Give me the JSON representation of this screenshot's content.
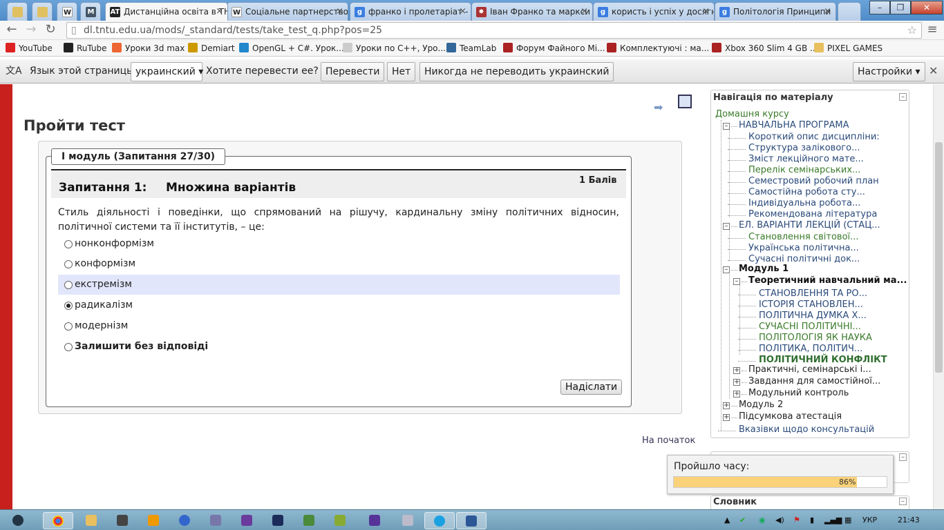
{
  "browser": {
    "tabs": [
      {
        "label": "",
        "icon": "pin-icon"
      },
      {
        "label": "",
        "icon": "pin-icon"
      },
      {
        "label": "",
        "icon": "wikipedia-icon"
      },
      {
        "label": "",
        "icon": "moodle-icon"
      },
      {
        "label": "Дистанційна освіта в ТН",
        "icon": "at-icon",
        "active": true
      },
      {
        "label": "Соціальне партнерство",
        "icon": "wikipedia-icon"
      },
      {
        "label": "франко і пролетаріат -",
        "icon": "google-icon"
      },
      {
        "label": "Іван Франко та маркси",
        "icon": "star-icon"
      },
      {
        "label": "користь і успіх у досягн",
        "icon": "google-icon"
      },
      {
        "label": "Політологія Принципи",
        "icon": "google-icon"
      }
    ],
    "url": "dl.tntu.edu.ua/mods/_standard/tests/take_test_q.php?pos=25",
    "bookmarks": [
      {
        "label": "YouTube",
        "color": "#d22"
      },
      {
        "label": "RuTube",
        "color": "#222"
      },
      {
        "label": "Уроки 3d max",
        "color": "#e63"
      },
      {
        "label": "Demiart",
        "color": "#c90"
      },
      {
        "label": "OpenGL + C#. Урок...",
        "color": "#28c"
      },
      {
        "label": "Уроки по C++, Уро...",
        "color": "#ccc"
      },
      {
        "label": "TeamLab",
        "color": "#369"
      },
      {
        "label": "Форум Файного Мі...",
        "color": "#a22"
      },
      {
        "label": "Комплектуючі : ма...",
        "color": "#a22"
      },
      {
        "label": "Xbox 360 Slim 4 GB ...",
        "color": "#a22"
      },
      {
        "label": "PIXEL GAMES",
        "color": "#e8c060"
      }
    ]
  },
  "translate": {
    "label": "Язык этой страницы",
    "language": "украинский",
    "question": "Хотите перевести ее?",
    "translate_btn": "Перевести",
    "no_btn": "Нет",
    "never_btn": "Никогда не переводить украинский",
    "settings_btn": "Настройки"
  },
  "page": {
    "title": "Пройти тест",
    "legend": "І модуль (Запитання 27/30)",
    "question_label": "Запитання 1:",
    "question_type": "Множина варіантів",
    "points": "1 Балів",
    "question_text": "Стиль діяльності і поведінки, що спрямований на рішучу, кардинальну зміну політичних відносин, політичної системи та її інститутів, – це:",
    "options": [
      {
        "label": "нонконформізм",
        "selected": false
      },
      {
        "label": "конформізм",
        "selected": false
      },
      {
        "label": "екстремізм",
        "selected": false,
        "highlighted": true
      },
      {
        "label": "радикалізм",
        "selected": true
      },
      {
        "label": "модернізм",
        "selected": false
      },
      {
        "label": "Залишити без відповіді",
        "selected": false,
        "bold": true
      }
    ],
    "submit": "Надіслати",
    "to_start": "На початок"
  },
  "nav": {
    "title": "Навігація по матеріалу",
    "home": "Домашня курсу",
    "items": [
      "НАВЧАЛЬНА ПРОГРАМА",
      "Короткий опис дисципліни:",
      "Структура залікового...",
      "Зміст лекційного мате...",
      "Перелік семінарських...",
      "Семестровий робочий план",
      "Самостійна робота сту...",
      "Індивідуальна робота...",
      "Рекомендована література",
      "ЕЛ. ВАРІАНТИ ЛЕКЦІЙ (СТАЦ...",
      "Становлення світової...",
      "Українська політична...",
      "Сучасні політичні док...",
      "Модуль 1",
      "Теоретичний навчальний ма...",
      "СТАНОВЛЕННЯ ТА РО...",
      "ІСТОРІЯ СТАНОВЛЕН...",
      "ПОЛІТИЧНА ДУМКА Х...",
      "СУЧАСНІ ПОЛІТИЧНІ...",
      "ПОЛІТОЛОГІЯ ЯК НАУКА",
      "ПОЛІТИКА, ПОЛІТИЧ...",
      "ПОЛІТИЧНИЙ КОНФЛІКТ",
      "Практичні, семінарські і...",
      "Завдання для самостійної...",
      "Модульний контроль",
      "Модуль 2",
      "Підсумкова атестація",
      "Вказівки щодо консультацій"
    ]
  },
  "timer": {
    "label": "Пройшло часу:",
    "percent": "86%",
    "value": 0.86
  },
  "dictionary": {
    "title": "Словник"
  },
  "taskbar": {
    "language": "УКР",
    "time": "21:43"
  }
}
